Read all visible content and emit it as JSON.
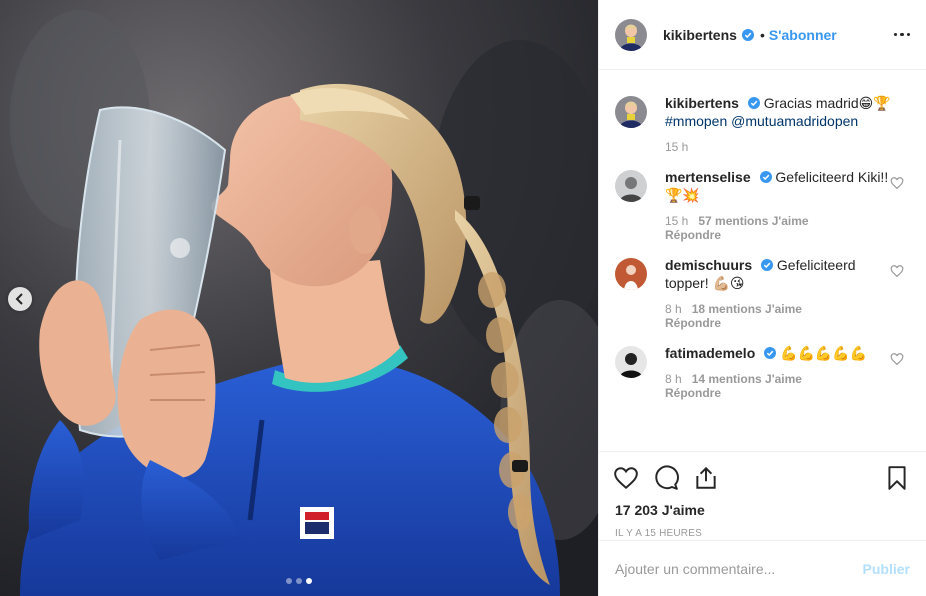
{
  "header": {
    "username": "kikibertens",
    "separator": "•",
    "follow_label": "S'abonner"
  },
  "caption": {
    "username": "kikibertens",
    "text": "Gracias madrid😁🏆",
    "tags": "#mmopen @mutuamadridopen",
    "time": "15 h"
  },
  "comments": [
    {
      "username": "mertenselise",
      "text": "Gefeliciteerd Kiki!! 🏆💥",
      "time": "15 h",
      "likes": "57 mentions J'aime",
      "reply": "Répondre"
    },
    {
      "username": "demischuurs",
      "text": "Gefeliciteerd topper! 💪🏼😘",
      "time": "8 h",
      "likes": "18 mentions J'aime",
      "reply": "Répondre"
    },
    {
      "username": "fatimademelo",
      "text": "💪💪💪💪💪",
      "time": "8 h",
      "likes": "14 mentions J'aime",
      "reply": "Répondre"
    }
  ],
  "post": {
    "likes": "17 203 J'aime",
    "posted": "IL Y A 15 HEURES"
  },
  "add_comment": {
    "placeholder": "Ajouter un commentaire...",
    "publish_label": "Publier"
  },
  "carousel": {
    "slides": 3,
    "active_index": 2
  },
  "colors": {
    "link": "#3897f0",
    "tag": "#003569",
    "muted": "#999999",
    "publish_disabled": "#b2dffc",
    "jacket": "#1f4fbf"
  },
  "icons": [
    "chevron-left-icon",
    "more-icon",
    "verified-icon",
    "heart-icon",
    "comment-icon",
    "share-icon",
    "bookmark-icon"
  ]
}
